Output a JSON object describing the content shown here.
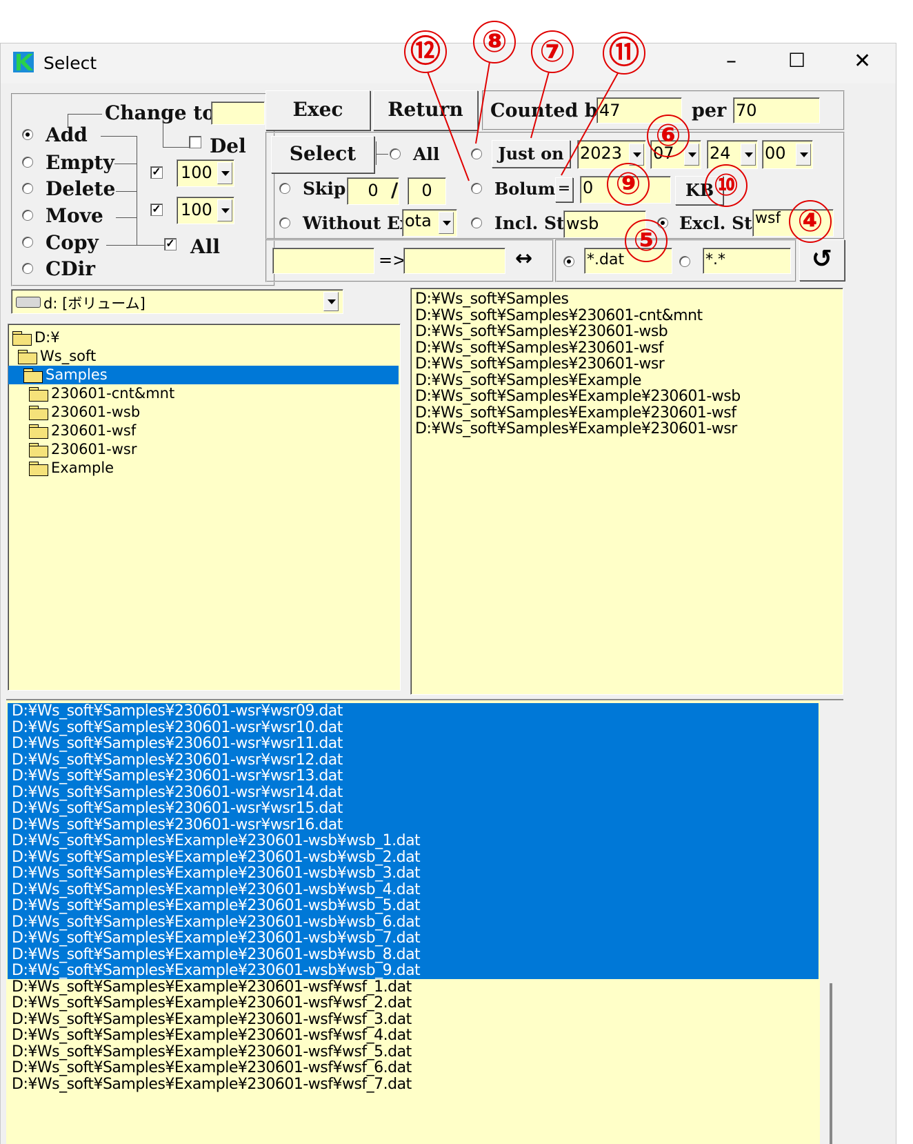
{
  "window": {
    "title": "Select",
    "minimize_glyph": "–",
    "maximize_glyph": "☐",
    "close_glyph": "✕"
  },
  "mode_panel": {
    "change_to_label": "Change to",
    "change_to_value": "",
    "options": [
      {
        "label": "Add",
        "selected": true
      },
      {
        "label": "Empty",
        "selected": false
      },
      {
        "label": "Delete",
        "selected": false
      },
      {
        "label": "Move",
        "selected": false
      },
      {
        "label": "Copy",
        "selected": false
      },
      {
        "label": "CDir",
        "selected": false
      }
    ],
    "del_label": "Del",
    "del_checked": false,
    "combo1_value": "100",
    "combo1_checked": true,
    "combo2_value": "100",
    "combo2_checked": true,
    "all_label": "All",
    "all_checked": true
  },
  "toolbar": {
    "exec_label": "Exec",
    "return_label": "Return",
    "counted_by_label": "Counted by",
    "counted_by_value": "47",
    "per_label": "per",
    "per_value": "70"
  },
  "select_panel": {
    "select_button": "Select",
    "all_label": "All",
    "just_on_label": "Just on",
    "year": "2023",
    "month": "07",
    "day": "24",
    "hour": "00",
    "skip_label": "Skip",
    "skip_from": "0",
    "skip_sep": "/",
    "skip_to": "0",
    "bolume_label": "Bolume",
    "bolume_op": "=",
    "bolume_value": "0",
    "kb_label": "KB",
    "without_ext_label": "Without Ext.",
    "without_ext_value": "ota",
    "incl_str_label": "Incl. Str",
    "incl_str_value": "wsb",
    "excl_str_label": "Excl. Str",
    "excl_str_value": "wsf",
    "excl_selected": true
  },
  "rename_row": {
    "from_value": "",
    "arrow": "=>",
    "to_value": "",
    "swap_glyph": "↔",
    "pattern1": "*.dat",
    "pattern1_selected": true,
    "pattern2": "*.*",
    "pattern2_selected": false,
    "refresh_glyph": "↺"
  },
  "drive": {
    "label": "d: [ボリューム]"
  },
  "tree": [
    {
      "label": "D:¥",
      "indent": 0,
      "open": true,
      "selected": false
    },
    {
      "label": "Ws_soft",
      "indent": 1,
      "open": true,
      "selected": false
    },
    {
      "label": "Samples",
      "indent": 2,
      "open": true,
      "selected": true
    },
    {
      "label": "230601-cnt&mnt",
      "indent": 3,
      "open": false,
      "selected": false
    },
    {
      "label": "230601-wsb",
      "indent": 3,
      "open": false,
      "selected": false
    },
    {
      "label": "230601-wsf",
      "indent": 3,
      "open": false,
      "selected": false
    },
    {
      "label": "230601-wsr",
      "indent": 3,
      "open": false,
      "selected": false
    },
    {
      "label": "Example",
      "indent": 3,
      "open": false,
      "selected": false
    }
  ],
  "dir_list": [
    "D:¥Ws_soft¥Samples",
    "D:¥Ws_soft¥Samples¥230601-cnt&mnt",
    "D:¥Ws_soft¥Samples¥230601-wsb",
    "D:¥Ws_soft¥Samples¥230601-wsf",
    "D:¥Ws_soft¥Samples¥230601-wsr",
    "D:¥Ws_soft¥Samples¥Example",
    "D:¥Ws_soft¥Samples¥Example¥230601-wsb",
    "D:¥Ws_soft¥Samples¥Example¥230601-wsf",
    "D:¥Ws_soft¥Samples¥Example¥230601-wsr"
  ],
  "file_list": [
    {
      "path": "D:¥Ws_soft¥Samples¥230601-wsr¥wsr09.dat",
      "selected": true
    },
    {
      "path": "D:¥Ws_soft¥Samples¥230601-wsr¥wsr10.dat",
      "selected": true
    },
    {
      "path": "D:¥Ws_soft¥Samples¥230601-wsr¥wsr11.dat",
      "selected": true
    },
    {
      "path": "D:¥Ws_soft¥Samples¥230601-wsr¥wsr12.dat",
      "selected": true
    },
    {
      "path": "D:¥Ws_soft¥Samples¥230601-wsr¥wsr13.dat",
      "selected": true
    },
    {
      "path": "D:¥Ws_soft¥Samples¥230601-wsr¥wsr14.dat",
      "selected": true
    },
    {
      "path": "D:¥Ws_soft¥Samples¥230601-wsr¥wsr15.dat",
      "selected": true
    },
    {
      "path": "D:¥Ws_soft¥Samples¥230601-wsr¥wsr16.dat",
      "selected": true
    },
    {
      "path": "D:¥Ws_soft¥Samples¥Example¥230601-wsb¥wsb_1.dat",
      "selected": true
    },
    {
      "path": "D:¥Ws_soft¥Samples¥Example¥230601-wsb¥wsb_2.dat",
      "selected": true
    },
    {
      "path": "D:¥Ws_soft¥Samples¥Example¥230601-wsb¥wsb_3.dat",
      "selected": true
    },
    {
      "path": "D:¥Ws_soft¥Samples¥Example¥230601-wsb¥wsb_4.dat",
      "selected": true
    },
    {
      "path": "D:¥Ws_soft¥Samples¥Example¥230601-wsb¥wsb_5.dat",
      "selected": true
    },
    {
      "path": "D:¥Ws_soft¥Samples¥Example¥230601-wsb¥wsb_6.dat",
      "selected": true
    },
    {
      "path": "D:¥Ws_soft¥Samples¥Example¥230601-wsb¥wsb_7.dat",
      "selected": true
    },
    {
      "path": "D:¥Ws_soft¥Samples¥Example¥230601-wsb¥wsb_8.dat",
      "selected": true
    },
    {
      "path": "D:¥Ws_soft¥Samples¥Example¥230601-wsb¥wsb_9.dat",
      "selected": true
    },
    {
      "path": "D:¥Ws_soft¥Samples¥Example¥230601-wsf¥wsf_1.dat",
      "selected": false
    },
    {
      "path": "D:¥Ws_soft¥Samples¥Example¥230601-wsf¥wsf_2.dat",
      "selected": false
    },
    {
      "path": "D:¥Ws_soft¥Samples¥Example¥230601-wsf¥wsf_3.dat",
      "selected": false
    },
    {
      "path": "D:¥Ws_soft¥Samples¥Example¥230601-wsf¥wsf_4.dat",
      "selected": false
    },
    {
      "path": "D:¥Ws_soft¥Samples¥Example¥230601-wsf¥wsf_5.dat",
      "selected": false
    },
    {
      "path": "D:¥Ws_soft¥Samples¥Example¥230601-wsf¥wsf_6.dat",
      "selected": false
    },
    {
      "path": "D:¥Ws_soft¥Samples¥Example¥230601-wsf¥wsf_7.dat",
      "selected": false
    }
  ],
  "markers": [
    "⑫",
    "⑧",
    "⑦",
    "⑪",
    "⑥",
    "⑨",
    "⑩",
    "④",
    "⑤"
  ],
  "colors": {
    "field_bg": "#ffffc8",
    "selection": "#0078d7",
    "marker": "#e00000",
    "app_icon": "#1a8cd8"
  }
}
